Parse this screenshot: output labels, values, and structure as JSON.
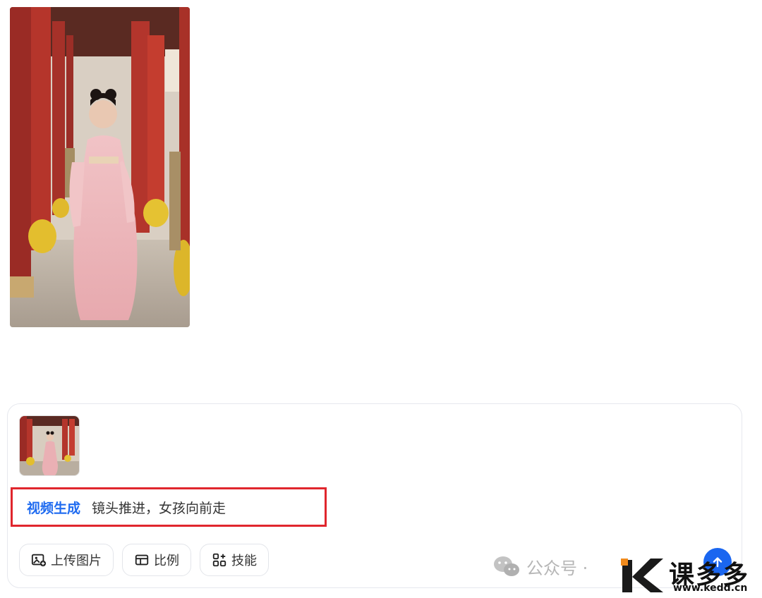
{
  "generated_image": {
    "icon": "palace-corridor-girl-image"
  },
  "composer": {
    "thumbnail": {
      "icon": "palace-corridor-girl-thumbnail"
    },
    "skill_tag": "视频生成",
    "prompt_text": "镜头推进，女孩向前走",
    "toolbar": {
      "upload_label": "上传图片",
      "ratio_label": "比例",
      "skills_label": "技能"
    },
    "send_icon": "arrow-up-icon"
  },
  "watermark": {
    "wechat_text": "公众号 ·",
    "brand_cn": "课多多",
    "brand_url": "www.kedd.cn"
  },
  "colors": {
    "accent": "#1a66f0",
    "skill_tag": "#1f6bf0",
    "highlight_border": "#e0262d"
  }
}
